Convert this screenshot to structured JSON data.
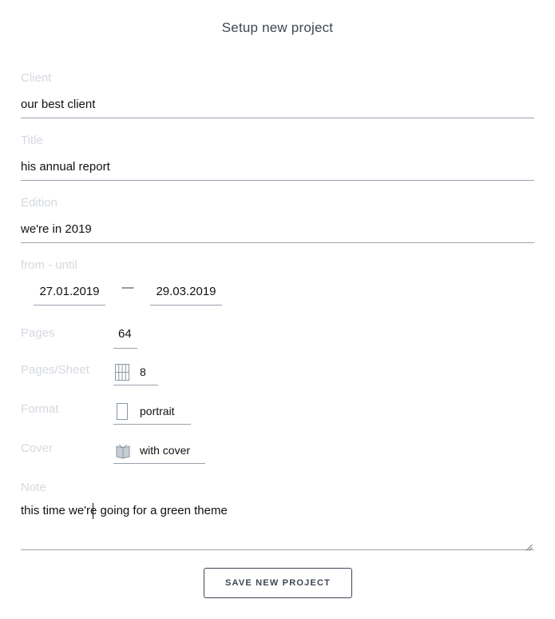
{
  "header": {
    "title": "Setup new project"
  },
  "client": {
    "label": "Client",
    "value": "our best client"
  },
  "title_field": {
    "label": "Title",
    "value": "his annual report"
  },
  "edition": {
    "label": "Edition",
    "value": "we're in 2019"
  },
  "period": {
    "label": "from - until",
    "from": "27.01.2019",
    "separator": "—",
    "until": "29.03.2019"
  },
  "pages": {
    "label": "Pages",
    "value": "64"
  },
  "pages_per_sheet": {
    "label": "Pages/Sheet",
    "value": "8",
    "icon": "sheet-grid-icon"
  },
  "format": {
    "label": "Format",
    "value": "portrait",
    "icon": "portrait-page-icon"
  },
  "cover": {
    "label": "Cover",
    "value": "with cover",
    "icon": "book-cover-icon"
  },
  "note": {
    "label": "Note",
    "value": "this time we're going for a green theme"
  },
  "actions": {
    "save_label": "SAVE NEW PROJECT"
  },
  "colors": {
    "label": "#d5d9df",
    "underline": "#9aa3ae",
    "accent": "#3d4654",
    "icon": "#8d97a3"
  }
}
